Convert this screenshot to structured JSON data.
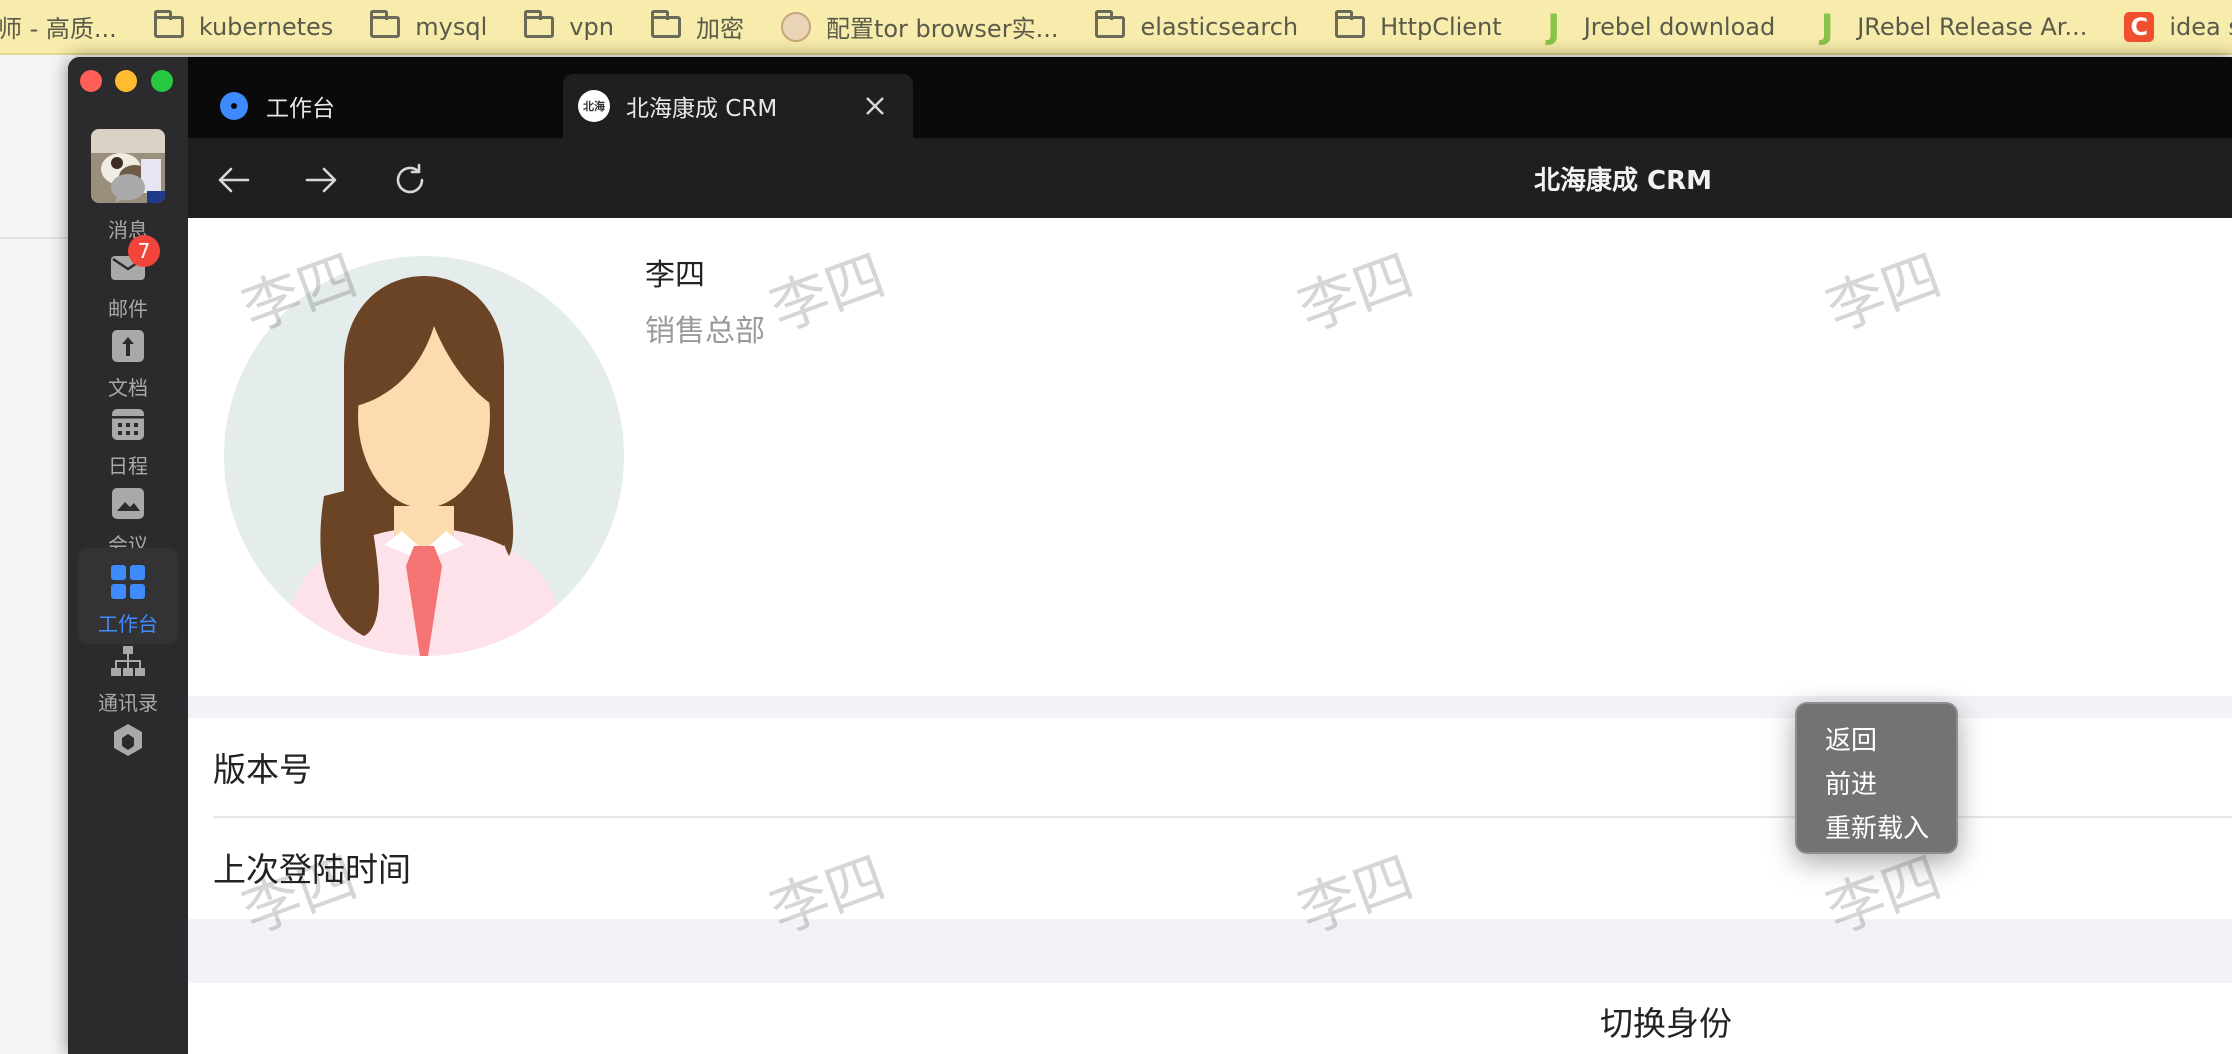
{
  "bookmarks": [
    {
      "label": "师 - 高质...",
      "icon": "none"
    },
    {
      "label": "kubernetes",
      "icon": "folder-icon"
    },
    {
      "label": "mysql",
      "icon": "folder-icon"
    },
    {
      "label": "vpn",
      "icon": "folder-icon"
    },
    {
      "label": "加密",
      "icon": "folder-icon"
    },
    {
      "label": "配置tor browser实...",
      "icon": "tor-favicon"
    },
    {
      "label": "elasticsearch",
      "icon": "folder-icon"
    },
    {
      "label": "HttpClient",
      "icon": "folder-icon"
    },
    {
      "label": "Jrebel download",
      "icon": "jrebel-favicon"
    },
    {
      "label": "JRebel Release Ar...",
      "icon": "jrebel-favicon"
    },
    {
      "label": "idea spring",
      "icon": "c-favicon"
    }
  ],
  "bookmark_icon_letters": {
    "jrebel": "J",
    "c": "C"
  },
  "sidebar": {
    "items": [
      {
        "label": "消息",
        "icon": "chat-bubble-icon"
      },
      {
        "label": "邮件",
        "icon": "mail-icon",
        "badge": "7"
      },
      {
        "label": "文档",
        "icon": "document-icon"
      },
      {
        "label": "日程",
        "icon": "calendar-icon"
      },
      {
        "label": "会议",
        "icon": "meeting-icon"
      },
      {
        "label": "工作台",
        "icon": "workbench-grid-icon",
        "active": true
      },
      {
        "label": "通讯录",
        "icon": "org-chart-icon"
      }
    ]
  },
  "tabs": [
    {
      "label": "工作台",
      "icon": "workbench-logo-icon"
    },
    {
      "label": "北海康成 CRM",
      "icon": "site-logo-icon",
      "icon_text": "北海",
      "active": true
    }
  ],
  "toolbar": {
    "title": "北海康成 CRM"
  },
  "profile": {
    "name": "李四",
    "department": "销售总部"
  },
  "info_rows": {
    "version_label": "版本号",
    "last_login_label": "上次登陆时间"
  },
  "actions": {
    "switch_identity": "切换身份"
  },
  "watermark": "李四",
  "context_menu": {
    "items": [
      "返回",
      "前进",
      "重新载入"
    ]
  },
  "colors": {
    "accent": "#3d8bff",
    "badge": "#f2463d",
    "sidebar_bg": "#2b2b2d"
  }
}
